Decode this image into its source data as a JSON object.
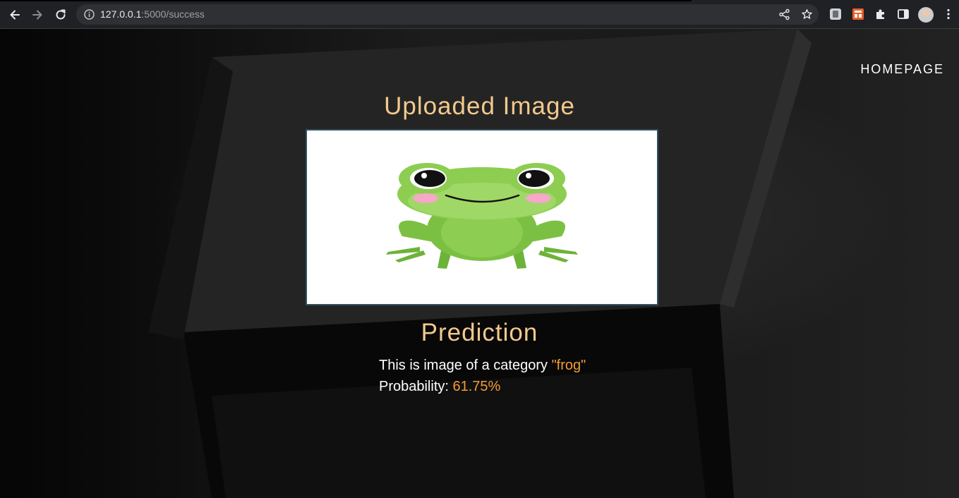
{
  "browser": {
    "url_host": "127.0.0.1",
    "url_path": ":5000/success"
  },
  "nav": {
    "homepage_label": "HOMEPAGE"
  },
  "main": {
    "uploaded_title": "Uploaded Image",
    "prediction_title": "Prediction",
    "category_prefix": "This is image of a category ",
    "category_value": "\"frog\"",
    "probability_prefix": "Probability: ",
    "probability_value": "61.75%"
  },
  "colors": {
    "heading": "#f3c98d",
    "accent": "#f39c35",
    "chrome_bg": "#202124",
    "omnibox_bg": "#2f3033"
  },
  "icons": {
    "back": "arrow-left",
    "forward": "arrow-right",
    "reload": "reload",
    "site_info": "info-circle",
    "share": "share",
    "bookmark": "star",
    "extensions": "puzzle",
    "side_panel": "side-panel",
    "menu": "kebab-menu"
  }
}
